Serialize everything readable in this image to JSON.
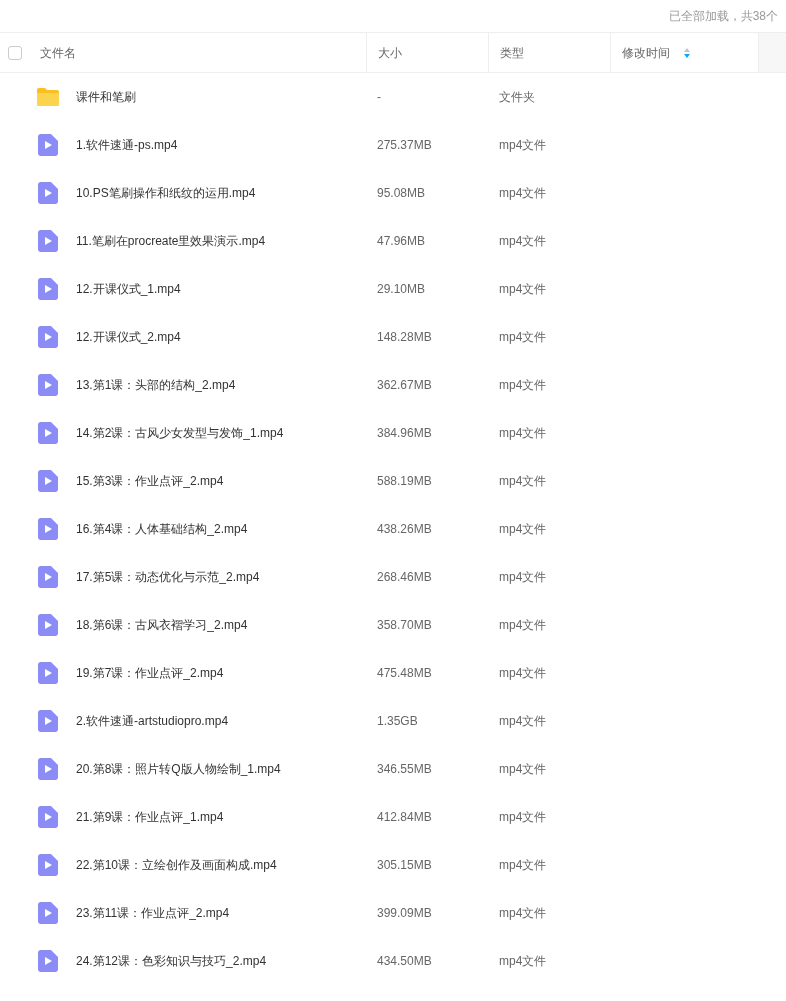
{
  "status": "已全部加载，共38个",
  "select_all": {
    "checked": false
  },
  "columns": [
    {
      "label": "文件名",
      "sort_indicator": false
    },
    {
      "label": "大小",
      "sort_indicator": false
    },
    {
      "label": "类型",
      "sort_indicator": false
    },
    {
      "label": "修改时间",
      "sort_indicator": true
    }
  ],
  "rows": [
    {
      "kind": "folder",
      "name": "课件和笔刷",
      "size": "-",
      "type": "文件夹"
    },
    {
      "kind": "video",
      "name": "1.软件速通-ps.mp4",
      "size": "275.37MB",
      "type": "mp4文件"
    },
    {
      "kind": "video",
      "name": "10.PS笔刷操作和纸纹的运用.mp4",
      "size": "95.08MB",
      "type": "mp4文件"
    },
    {
      "kind": "video",
      "name": "11.笔刷在procreate里效果演示.mp4",
      "size": "47.96MB",
      "type": "mp4文件"
    },
    {
      "kind": "video",
      "name": "12.开课仪式_1.mp4",
      "size": "29.10MB",
      "type": "mp4文件"
    },
    {
      "kind": "video",
      "name": "12.开课仪式_2.mp4",
      "size": "148.28MB",
      "type": "mp4文件"
    },
    {
      "kind": "video",
      "name": "13.第1课：头部的结构_2.mp4",
      "size": "362.67MB",
      "type": "mp4文件"
    },
    {
      "kind": "video",
      "name": "14.第2课：古风少女发型与发饰_1.mp4",
      "size": "384.96MB",
      "type": "mp4文件"
    },
    {
      "kind": "video",
      "name": "15.第3课：作业点评_2.mp4",
      "size": "588.19MB",
      "type": "mp4文件"
    },
    {
      "kind": "video",
      "name": "16.第4课：人体基础结构_2.mp4",
      "size": "438.26MB",
      "type": "mp4文件"
    },
    {
      "kind": "video",
      "name": "17.第5课：动态优化与示范_2.mp4",
      "size": "268.46MB",
      "type": "mp4文件"
    },
    {
      "kind": "video",
      "name": "18.第6课：古风衣褶学习_2.mp4",
      "size": "358.70MB",
      "type": "mp4文件"
    },
    {
      "kind": "video",
      "name": "19.第7课：作业点评_2.mp4",
      "size": "475.48MB",
      "type": "mp4文件"
    },
    {
      "kind": "video",
      "name": "2.软件速通-artstudiopro.mp4",
      "size": "1.35GB",
      "type": "mp4文件"
    },
    {
      "kind": "video",
      "name": "20.第8课：照片转Q版人物绘制_1.mp4",
      "size": "346.55MB",
      "type": "mp4文件"
    },
    {
      "kind": "video",
      "name": "21.第9课：作业点评_1.mp4",
      "size": "412.84MB",
      "type": "mp4文件"
    },
    {
      "kind": "video",
      "name": "22.第10课：立绘创作及画面构成.mp4",
      "size": "305.15MB",
      "type": "mp4文件"
    },
    {
      "kind": "video",
      "name": "23.第11课：作业点评_2.mp4",
      "size": "399.09MB",
      "type": "mp4文件"
    },
    {
      "kind": "video",
      "name": "24.第12课：色彩知识与技巧_2.mp4",
      "size": "434.50MB",
      "type": "mp4文件"
    }
  ]
}
